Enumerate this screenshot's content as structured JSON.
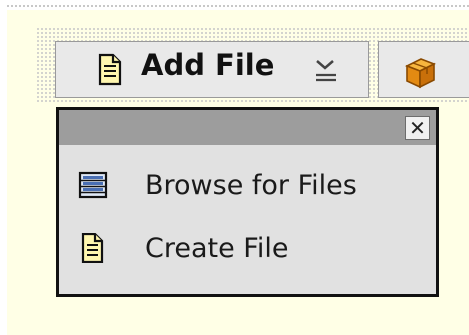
{
  "toolbar": {
    "add_file_label": "Add File"
  },
  "menu": {
    "close_label": "✕",
    "items": [
      {
        "label": "Browse for Files",
        "icon": "browse-files-icon"
      },
      {
        "label": "Create File",
        "icon": "document-icon"
      }
    ]
  },
  "colors": {
    "pane_background": "#ffffe6",
    "button_background": "#e9e9e9",
    "menu_background": "#e1e1e1",
    "menu_header": "#9d9d9d",
    "menu_border": "#111111"
  }
}
